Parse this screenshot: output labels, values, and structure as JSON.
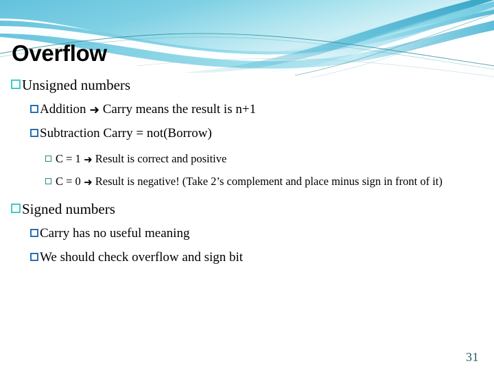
{
  "slide": {
    "title": "Overflow",
    "page_number": "31",
    "theme": {
      "accent_cyan": "#3FC8D2",
      "accent_blue": "#2570B4",
      "accent_teal": "#2E8287",
      "page_number_color": "#1F5F63",
      "header_gradient_start": "#6FC5DE",
      "header_gradient_end": "#BEE9F2",
      "background": "#FFFFFF"
    }
  },
  "content": {
    "blocks": [
      {
        "level": 1,
        "bullet": "hollow-square-cyan",
        "text": "Unsigned numbers"
      },
      {
        "level": 2,
        "bullet": "hollow-square-blue",
        "text_before_arrow": "Addition ",
        "arrow": "➜",
        "text_after_arrow": " Carry means the result is n+1"
      },
      {
        "level": 2,
        "bullet": "hollow-square-blue",
        "text": "Subtraction Carry = not(Borrow)"
      },
      {
        "level": 3,
        "bullet": "hollow-square-teal",
        "text_before_arrow": "C = 1 ",
        "arrow": "➜",
        "text_after_arrow": " Result is correct and positive"
      },
      {
        "level": 3,
        "bullet": "hollow-square-teal",
        "text_before_arrow": "C = 0 ",
        "arrow": "➜",
        "text_after_arrow": " Result is negative! (Take 2’s complement and place minus sign in front of it)"
      },
      {
        "level": 1,
        "bullet": "hollow-square-cyan",
        "text": "Signed numbers"
      },
      {
        "level": 2,
        "bullet": "hollow-square-blue",
        "text": "Carry has no useful meaning"
      },
      {
        "level": 2,
        "bullet": "hollow-square-blue",
        "text": "We should check overflow and sign bit"
      }
    ]
  }
}
